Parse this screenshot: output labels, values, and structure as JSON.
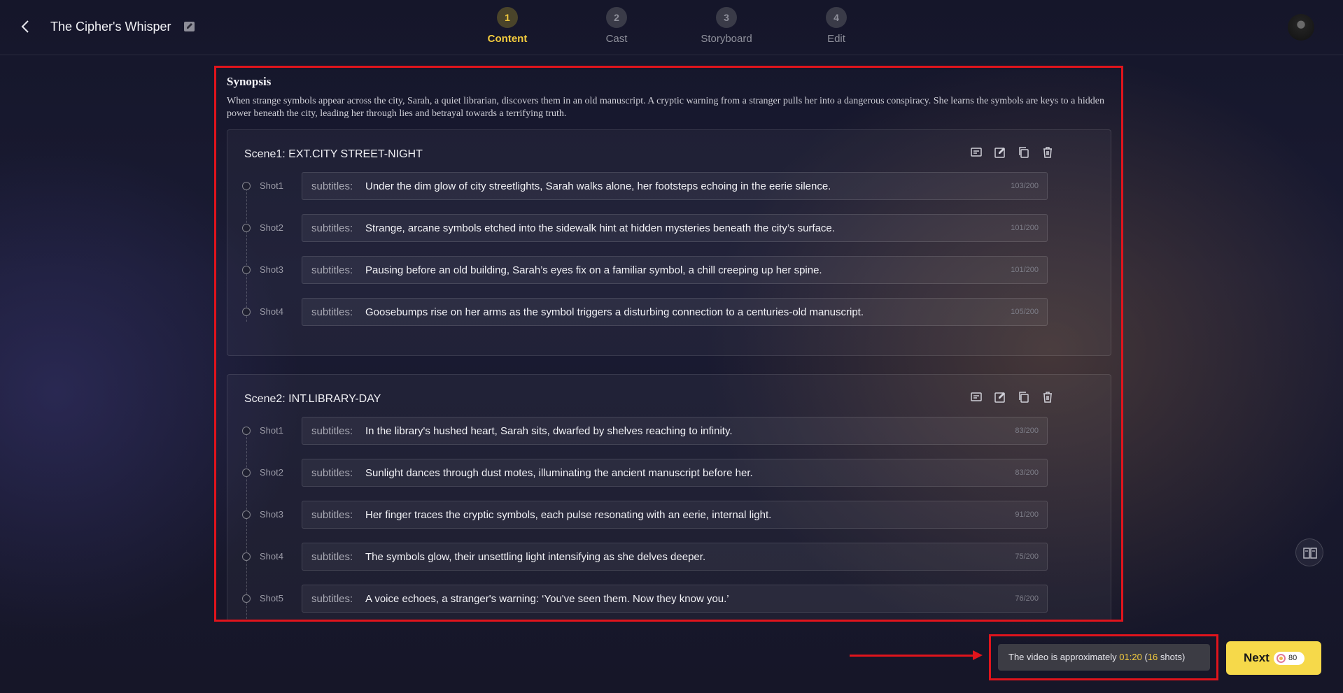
{
  "header": {
    "title": "The Cipher's Whisper",
    "steps": [
      {
        "num": "1",
        "label": "Content",
        "active": true
      },
      {
        "num": "2",
        "label": "Cast"
      },
      {
        "num": "3",
        "label": "Storyboard"
      },
      {
        "num": "4",
        "label": "Edit"
      }
    ]
  },
  "synopsis": {
    "title": "Synopsis",
    "text": "When strange symbols appear across the city, Sarah, a quiet librarian, discovers them in an old manuscript. A cryptic warning from a stranger pulls her into a dangerous conspiracy. She learns the symbols are keys to a hidden power beneath the city, leading her through lies and betrayal towards a terrifying truth."
  },
  "subtitle_prefix": "subtitles:",
  "scenes": [
    {
      "title": "Scene1: EXT.CITY STREET-NIGHT",
      "shots": [
        {
          "label": "Shot1",
          "text": "Under the dim glow of city streetlights, Sarah walks alone, her footsteps echoing in the eerie silence.",
          "count": "103/200"
        },
        {
          "label": "Shot2",
          "text": "Strange, arcane symbols etched into the sidewalk hint at hidden mysteries beneath the city’s surface.",
          "count": "101/200"
        },
        {
          "label": "Shot3",
          "text": "Pausing before an old building, Sarah’s eyes fix on a familiar symbol, a chill creeping up her spine.",
          "count": "101/200"
        },
        {
          "label": "Shot4",
          "text": "Goosebumps rise on her arms as the symbol triggers a disturbing connection to a centuries-old manuscript.",
          "count": "105/200"
        }
      ]
    },
    {
      "title": "Scene2: INT.LIBRARY-DAY",
      "shots": [
        {
          "label": "Shot1",
          "text": "In the library's hushed heart, Sarah sits, dwarfed by shelves reaching to infinity.",
          "count": "83/200"
        },
        {
          "label": "Shot2",
          "text": "Sunlight dances through dust motes, illuminating the ancient manuscript before her.",
          "count": "83/200"
        },
        {
          "label": "Shot3",
          "text": "Her finger traces the cryptic symbols, each pulse resonating with an eerie, internal light.",
          "count": "91/200"
        },
        {
          "label": "Shot4",
          "text": "The symbols glow, their unsettling light intensifying as she delves deeper.",
          "count": "75/200"
        },
        {
          "label": "Shot5",
          "text": "A voice echoes, a stranger's warning: ‘You've seen them. Now they know you.’",
          "count": "76/200"
        }
      ]
    }
  ],
  "footer": {
    "duration_prefix": "The video is approximately",
    "duration": "01:20",
    "open_paren": "(",
    "shot_count": "16",
    "shots_suffix": "shots)",
    "next_label": "Next",
    "credit_cost": "80"
  },
  "colors": {
    "accent": "#f3cb3e",
    "next_button": "#f6d94a",
    "annotation_red": "#e0141c"
  },
  "icons": [
    "back-arrow-icon",
    "edit-icon",
    "regenerate-icon",
    "edit-scene-icon",
    "copy-icon",
    "delete-icon",
    "book-guide-icon",
    "coin-icon"
  ]
}
